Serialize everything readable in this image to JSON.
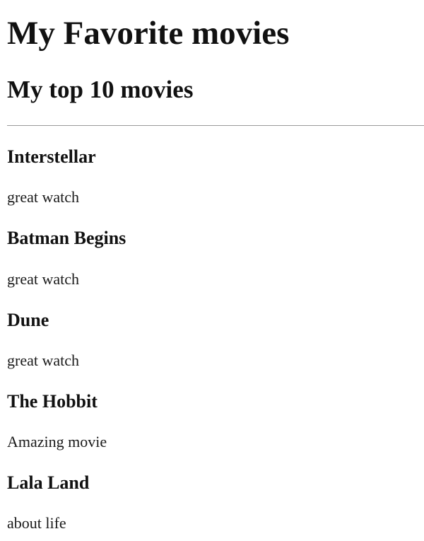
{
  "page": {
    "title": "My Favorite movies",
    "subtitle": "My top 10 movies"
  },
  "movies": [
    {
      "title": "Interstellar",
      "note": "great watch"
    },
    {
      "title": "Batman Begins",
      "note": "great watch"
    },
    {
      "title": "Dune",
      "note": "great watch"
    },
    {
      "title": "The Hobbit",
      "note": "Amazing movie"
    },
    {
      "title": "Lala Land",
      "note": "about life"
    }
  ]
}
